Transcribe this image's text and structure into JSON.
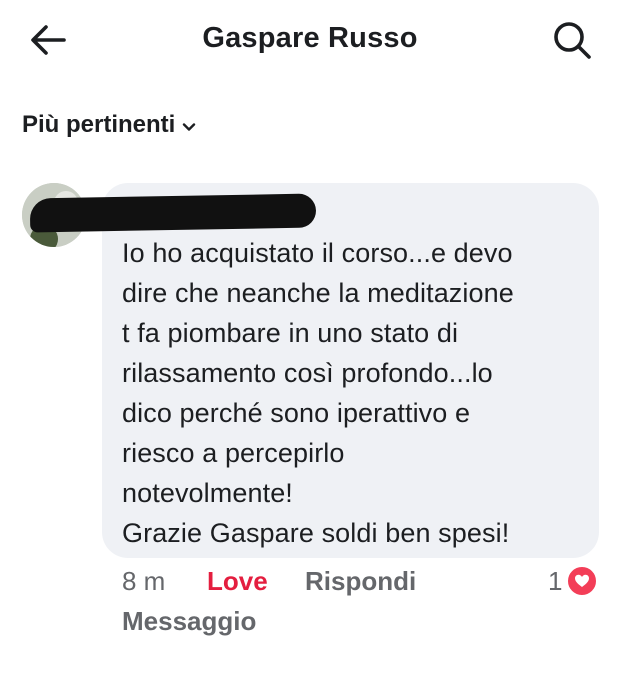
{
  "header": {
    "title": "Gaspare Russo",
    "back_icon": "arrow-left-icon",
    "search_icon": "search-icon"
  },
  "sort": {
    "label": "Più pertinenti",
    "icon": "chevron-down-icon"
  },
  "comment": {
    "author_redacted": true,
    "text": "Io ho acquistato il corso...e devo\ndire che neanche la meditazione\nt fa piombare in uno stato di\nrilassamento così profondo...lo\ndico perché sono iperattivo e\nriesco a percepirlo\nnotevolmente!\nGrazie Gaspare soldi ben spesi!",
    "time": "8 m",
    "love_label": "Love",
    "reply_label": "Rispondi",
    "message_label": "Messaggio",
    "reaction_count": "1",
    "reaction_icon": "heart-icon"
  },
  "colors": {
    "love": "#e41e3f",
    "bubble": "#eff1f5",
    "reaction": "#f33e58",
    "meta": "#65676b"
  }
}
